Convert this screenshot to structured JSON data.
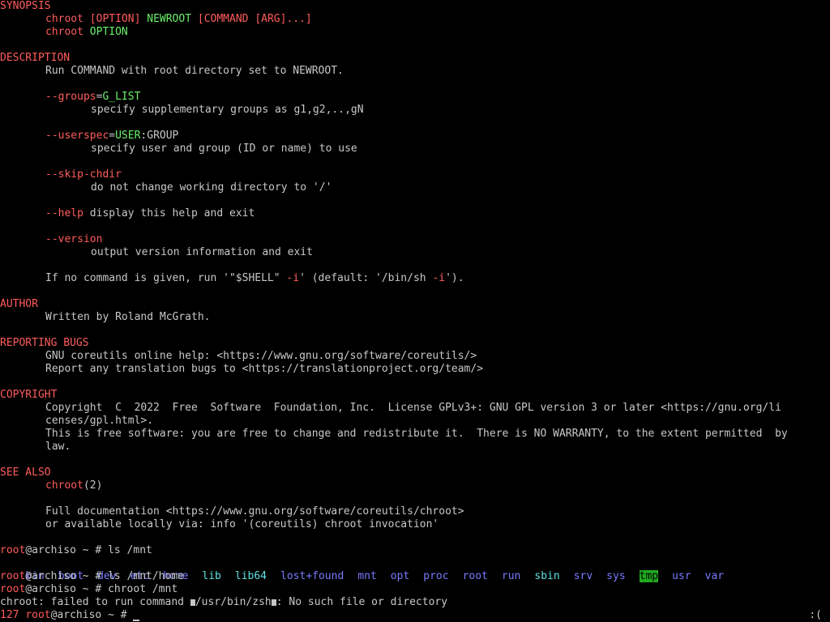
{
  "synopsis": {
    "title": "SYNOPSIS",
    "line1": {
      "cmd": "chroot",
      "opt": "[OPTION]",
      "newroot": "NEWROOT",
      "rest": "[COMMAND [ARG]...]"
    },
    "line2": {
      "cmd": "chroot",
      "opt": "OPTION"
    }
  },
  "description": {
    "title": "DESCRIPTION",
    "text": "Run COMMAND with root directory set to NEWROOT.",
    "opt_groups": {
      "flag": "--groups",
      "eq": "=",
      "arg": "G_LIST",
      "desc": "specify supplementary groups as g1,g2,..,gN"
    },
    "opt_userspec": {
      "flag": "--userspec",
      "eq": "=",
      "arg": "USER",
      "rest": ":GROUP",
      "desc": "specify user and group (ID or name) to use"
    },
    "opt_skip": {
      "flag": "--skip-chdir",
      "desc": "do not change working directory to '/'"
    },
    "opt_help": {
      "flag": "--help",
      "desc": " display this help and exit"
    },
    "opt_version": {
      "flag": "--version",
      "desc": "output version information and exit"
    },
    "note": {
      "a": "If no command is given, run '\"$SHELL\" ",
      "b": "-i",
      "c": "' (default: '/bin/sh ",
      "d": "-i",
      "e": "')."
    }
  },
  "author": {
    "title": "AUTHOR",
    "text": "Written by Roland McGrath."
  },
  "bugs": {
    "title": "REPORTING BUGS",
    "line1": "GNU coreutils online help: <https://www.gnu.org/software/coreutils/>",
    "line2": "Report any translation bugs to <https://translationproject.org/team/>"
  },
  "copyright": {
    "title": "COPYRIGHT",
    "line1": "Copyright  C  2022  Free  Software  Foundation, Inc.  License GPLv3+: GNU GPL version 3 or later <https://gnu.org/li",
    "line2": "censes/gpl.html>.",
    "line3": "This is free software: you are free to change and redistribute it.  There is NO WARRANTY, to the extent permitted  by",
    "line4": "law."
  },
  "see_also": {
    "title": "SEE ALSO",
    "ref": "chroot",
    "ref_sec": "(2)",
    "doc1": "Full documentation <https://www.gnu.org/software/coreutils/chroot>",
    "doc2": "or available locally via: info '(coreutils) chroot invocation'"
  },
  "shell": {
    "user": "root",
    "host": "@archiso ~ # ",
    "cmd1": "ls /mnt",
    "dirs": [
      "bin",
      "boot",
      "dev",
      "etc",
      "home",
      "lib",
      "lib64",
      "lost+found",
      "mnt",
      "opt",
      "proc",
      "root",
      "run",
      "sbin",
      "srv",
      "sys",
      "tmp",
      "usr",
      "var"
    ],
    "cmd2": "ls /mnt/home",
    "cmd3": "chroot /mnt",
    "error_a": "chroot: failed to run command ",
    "error_b": "/usr/bin/zsh",
    "error_c": ": No such file or directory",
    "exit_code": "127 ",
    "status_face": ":("
  },
  "colors": {
    "heading": "#ff5c5c",
    "option": "#6af06a",
    "dir": "#7a7aff",
    "link": "#5fe0e0",
    "tmp_bg": "#1faa1f"
  }
}
